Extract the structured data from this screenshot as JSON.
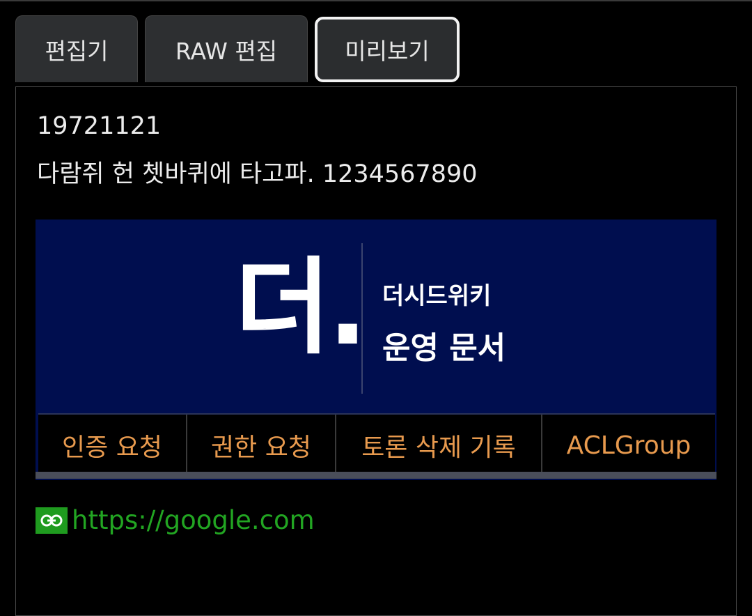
{
  "tabs": [
    {
      "label": "편집기"
    },
    {
      "label": "RAW 편집"
    },
    {
      "label": "미리보기",
      "active": true
    }
  ],
  "preview": {
    "line1": "19721121",
    "line2": "다람쥐 헌 쳇바퀴에 타고파. 1234567890"
  },
  "banner": {
    "logo": "더.",
    "wiki_name": "더시드위키",
    "doc_type": "운영 문서",
    "background": "#000e4f",
    "nav": [
      {
        "label": "인증 요청"
      },
      {
        "label": "권한 요청"
      },
      {
        "label": "토론 삭제 기록"
      },
      {
        "label": "ACLGroup"
      }
    ],
    "nav_color": "#e89a4e"
  },
  "link": {
    "icon": "link-icon",
    "text": "https://google.com",
    "color": "#22a522"
  }
}
